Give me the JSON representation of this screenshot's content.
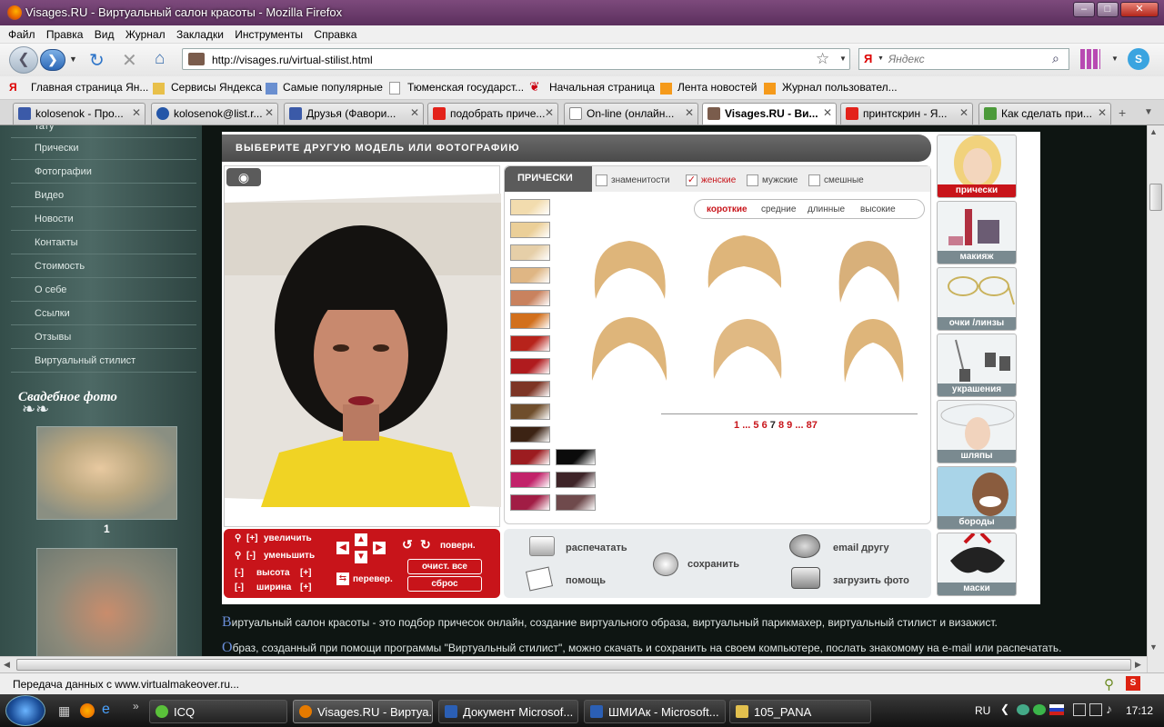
{
  "window": {
    "title": "Visages.RU - Виртуальный салон красоты - Mozilla Firefox"
  },
  "menu": [
    "Файл",
    "Правка",
    "Вид",
    "Журнал",
    "Закладки",
    "Инструменты",
    "Справка"
  ],
  "nav": {
    "url": "http://visages.ru/virtual-stilist.html",
    "search_placeholder": "Яндекс",
    "search_engine": "Я"
  },
  "bookmarks": [
    "Главная страница Ян...",
    "Сервисы Яндекса",
    "Самые популярные",
    "Тюменская государст...",
    "Начальная страница",
    "Лента новостей",
    "Журнал пользовател..."
  ],
  "tabs": [
    {
      "label": "kolosenok - Про..."
    },
    {
      "label": "kolosenok@list.r..."
    },
    {
      "label": "Друзья (Фавори..."
    },
    {
      "label": "подобрать приче..."
    },
    {
      "label": "On-line (онлайн..."
    },
    {
      "label": "Visages.RU - Ви..."
    },
    {
      "label": "принтскрин - Я..."
    },
    {
      "label": "Как сделать при..."
    }
  ],
  "sidebar": {
    "items": [
      "тату",
      "Прически",
      "Фотографии",
      "Видео",
      "Новости",
      "Контакты",
      "Стоимость",
      "О себе",
      "Ссылки",
      "Отзывы",
      "Виртуальный стилист"
    ],
    "section_title": "Свадебное фото",
    "photo_caption": "1"
  },
  "app": {
    "header": "ВЫБЕРИТЕ ДРУГУЮ МОДЕЛЬ ИЛИ ФОТОГРАФИЮ",
    "tab_hairstyles": "ПРИЧЕСКИ",
    "filters": [
      {
        "label": "знаменитости",
        "checked": false
      },
      {
        "label": "женские",
        "checked": true
      },
      {
        "label": "мужские",
        "checked": false
      },
      {
        "label": "смешные",
        "checked": false
      }
    ],
    "lengths": [
      "короткие",
      "средние",
      "длинные",
      "высокие"
    ],
    "active_length": "короткие",
    "pagination": [
      "1",
      "...",
      "5",
      "6",
      "7",
      "8",
      "9",
      "...",
      "87"
    ],
    "current_page": "7",
    "swatch_colors": [
      "#f2dcae",
      "#ebcf98",
      "#e6cfa8",
      "#dfb684",
      "#c9825e",
      "#d2701d",
      "#b7231b",
      "#b01b1e",
      "#7d3525",
      "#6f4e2c",
      "#3c2314",
      "#9c1c20",
      "#c2236a",
      "#a11d45",
      "#0b0b0b",
      "#3e2428",
      "#6f4a4c"
    ],
    "controls": {
      "zoom_in": "увеличить",
      "zoom_out": "уменьшить",
      "zoom_in_sym": "[+]",
      "zoom_out_sym": "[-]",
      "height": "высота",
      "width": "ширина",
      "minus": "[-]",
      "plus": "[+]",
      "rotate": "поверн.",
      "flip": "перевер.",
      "clear_all": "очист. все",
      "reset": "сброс"
    },
    "actions": [
      "распечатать",
      "помощь",
      "сохранить",
      "email другу",
      "загрузить фото"
    ],
    "right_panels": [
      "прически",
      "макияж",
      "очки /линзы",
      "украшения",
      "шляпы",
      "бороды",
      "маски"
    ]
  },
  "page_text": [
    {
      "initial": "В",
      "text": "иртуальный салон красоты - это подбор причесок онлайн, создание виртуального образа, виртуальный парикмахер, виртуальный стилист и визажист."
    },
    {
      "initial": "О",
      "text": "браз, созданный при помощи программы \"Виртуальный стилист\", можно скачать и сохранить на своем компьютере, послать знакомому на e-mail или распечатать."
    }
  ],
  "status": "Передача данных с www.virtualmakeover.ru...",
  "taskbar": {
    "tasks": [
      "ICQ",
      "Visages.RU - Виртуа...",
      "Документ Microsof...",
      "ШМИАк - Microsoft...",
      "105_PANA"
    ],
    "lang": "RU",
    "clock": "17:12"
  },
  "colors": {
    "accent_red": "#c8141a",
    "header_gray": "#5b5b5b",
    "sidebar": "#3e5a56"
  }
}
